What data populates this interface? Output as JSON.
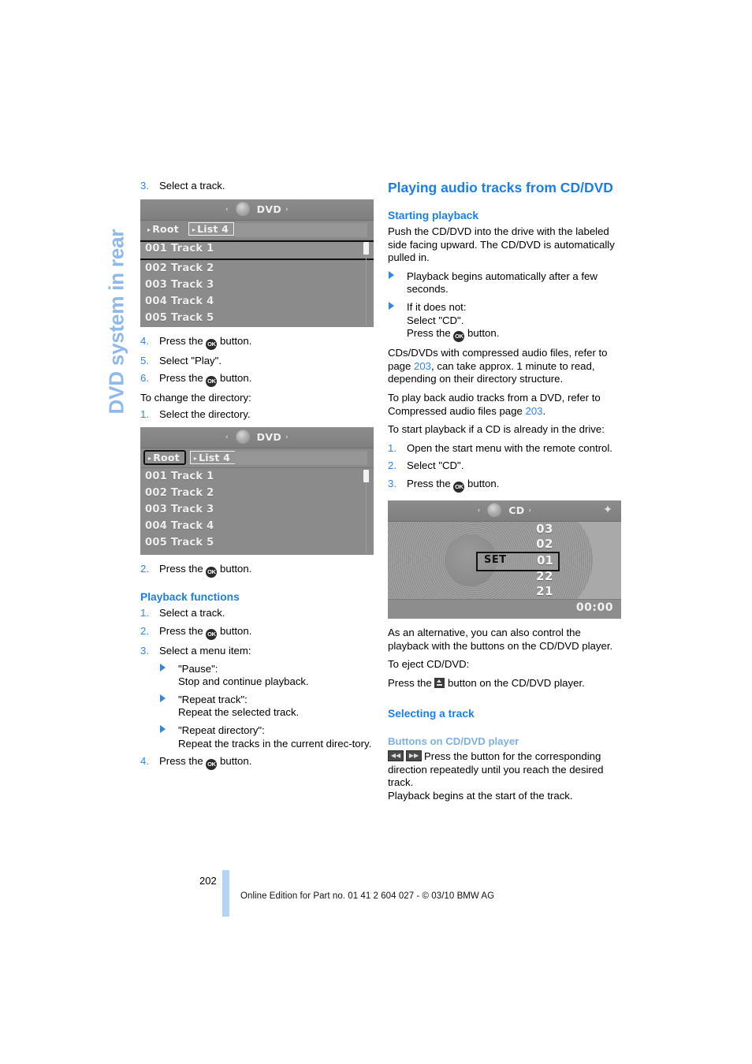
{
  "colors": {
    "accent_blue": "#1a7fe8",
    "link_blue": "#2f86ef",
    "light_blue": "#7fb0e4",
    "tab_blue": "#8fb9e8",
    "footer_bar": "#b5d3f2"
  },
  "chapter_tab": {
    "label": "DVD system in rear"
  },
  "left_column": {
    "step_3": {
      "num": "3.",
      "text": "Select a track."
    },
    "screenshot_1": {
      "title": "DVD",
      "left_arrow": "‹",
      "right_arrow": "›",
      "crumbs": [
        {
          "label": "Root",
          "state": "normal"
        },
        {
          "label": "List 4",
          "state": "selected-light"
        }
      ],
      "tracks": [
        {
          "num": "001",
          "name": "Track 1",
          "highlight": true
        },
        {
          "num": "002",
          "name": "Track 2",
          "highlight": false
        },
        {
          "num": "003",
          "name": "Track 3",
          "highlight": false
        },
        {
          "num": "004",
          "name": "Track 4",
          "highlight": false
        },
        {
          "num": "005",
          "name": "Track 5",
          "highlight": false
        }
      ]
    },
    "step_4": {
      "num": "4.",
      "pre": "Press the ",
      "post": " button.",
      "icon": "ok"
    },
    "step_5": {
      "num": "5.",
      "text": "Select \"Play\"."
    },
    "step_6": {
      "num": "6.",
      "pre": "Press the ",
      "post": " button.",
      "icon": "ok"
    },
    "change_dir_intro": "To change the directory:",
    "dir_step_1": {
      "num": "1.",
      "text": "Select the directory."
    },
    "screenshot_2": {
      "title": "DVD",
      "left_arrow": "‹",
      "right_arrow": "›",
      "crumbs": [
        {
          "label": "Root",
          "state": "selected-outline"
        },
        {
          "label": "List 4",
          "state": "selected-light"
        }
      ],
      "tracks": [
        {
          "num": "001",
          "name": "Track 1",
          "highlight": false
        },
        {
          "num": "002",
          "name": "Track 2",
          "highlight": false
        },
        {
          "num": "003",
          "name": "Track 3",
          "highlight": false
        },
        {
          "num": "004",
          "name": "Track 4",
          "highlight": false
        },
        {
          "num": "005",
          "name": "Track 5",
          "highlight": false
        }
      ]
    },
    "dir_step_2": {
      "num": "2.",
      "pre": "Press the ",
      "post": " button.",
      "icon": "ok"
    },
    "playback_functions": {
      "heading": "Playback functions",
      "step_1": {
        "num": "1.",
        "text": "Select a track."
      },
      "step_2": {
        "num": "2.",
        "pre": "Press the ",
        "post": " button.",
        "icon": "ok"
      },
      "step_3": {
        "num": "3.",
        "text": "Select a menu item:"
      },
      "menu_items": [
        {
          "title": "\"Pause\":",
          "desc": "Stop and continue playback."
        },
        {
          "title": "\"Repeat track\":",
          "desc": "Repeat the selected track."
        },
        {
          "title": "\"Repeat directory\":",
          "desc": "Repeat the tracks in the current direc-tory."
        }
      ],
      "step_4": {
        "num": "4.",
        "pre": "Press the ",
        "post": " button.",
        "icon": "ok"
      }
    }
  },
  "right_column": {
    "heading": "Playing audio tracks from CD/DVD",
    "starting_playback": {
      "heading": "Starting playback",
      "intro": "Push the CD/DVD into the drive with the labeled side facing upward. The CD/DVD is automatically pulled in.",
      "bullet_1": "Playback begins automatically after a few seconds.",
      "bullet_2_line1": "If it does not:",
      "bullet_2_line2": "Select \"CD\".",
      "bullet_2_line3_pre": "Press the ",
      "bullet_2_line3_post": " button.",
      "compressed_note_pre": "CDs/DVDs with compressed audio files, refer to page ",
      "compressed_note_link": "203",
      "compressed_note_post": ", can take approx. 1 minute to read, depending on their directory structure.",
      "dvd_note_pre": "To play back audio tracks from a DVD, refer to Compressed audio files page ",
      "dvd_note_link": "203",
      "dvd_note_post": ".",
      "already_in_drive": "To start playback if a CD is already in the drive:",
      "step_1": {
        "num": "1.",
        "text": "Open the start menu with the remote control."
      },
      "step_2": {
        "num": "2.",
        "text": "Select \"CD\"."
      },
      "step_3": {
        "num": "3.",
        "pre": "Press the ",
        "post": " button.",
        "icon": "ok"
      }
    },
    "screenshot_cd": {
      "title": "CD",
      "left_arrow": "‹",
      "right_arrow": "›",
      "corner_icon": "navigation-diamond-icon",
      "numbers_above": [
        "03",
        "02"
      ],
      "set_label": "SET",
      "set_value": "01",
      "numbers_below": [
        "22",
        "21"
      ],
      "time": "00:00"
    },
    "alt_note": "As an alternative, you can also control the playback with the buttons on the CD/DVD player.",
    "eject_intro": "To eject CD/DVD:",
    "eject_line_pre": "Press the ",
    "eject_line_post": " button on the CD/DVD player.",
    "selecting_track": {
      "heading": "Selecting a track",
      "subheading": "Buttons on CD/DVD player",
      "skip_back_icon": "⧏⧏",
      "skip_fwd_icon": "⧐⧐",
      "body_line1": "Press the button for the corresponding direction repeatedly until you reach the desired track.",
      "body_line2": "Playback begins at the start of the track."
    }
  },
  "footer": {
    "page_number": "202",
    "note": "Online Edition for Part no. 01 41 2 604 027 - © 03/10 BMW AG"
  }
}
